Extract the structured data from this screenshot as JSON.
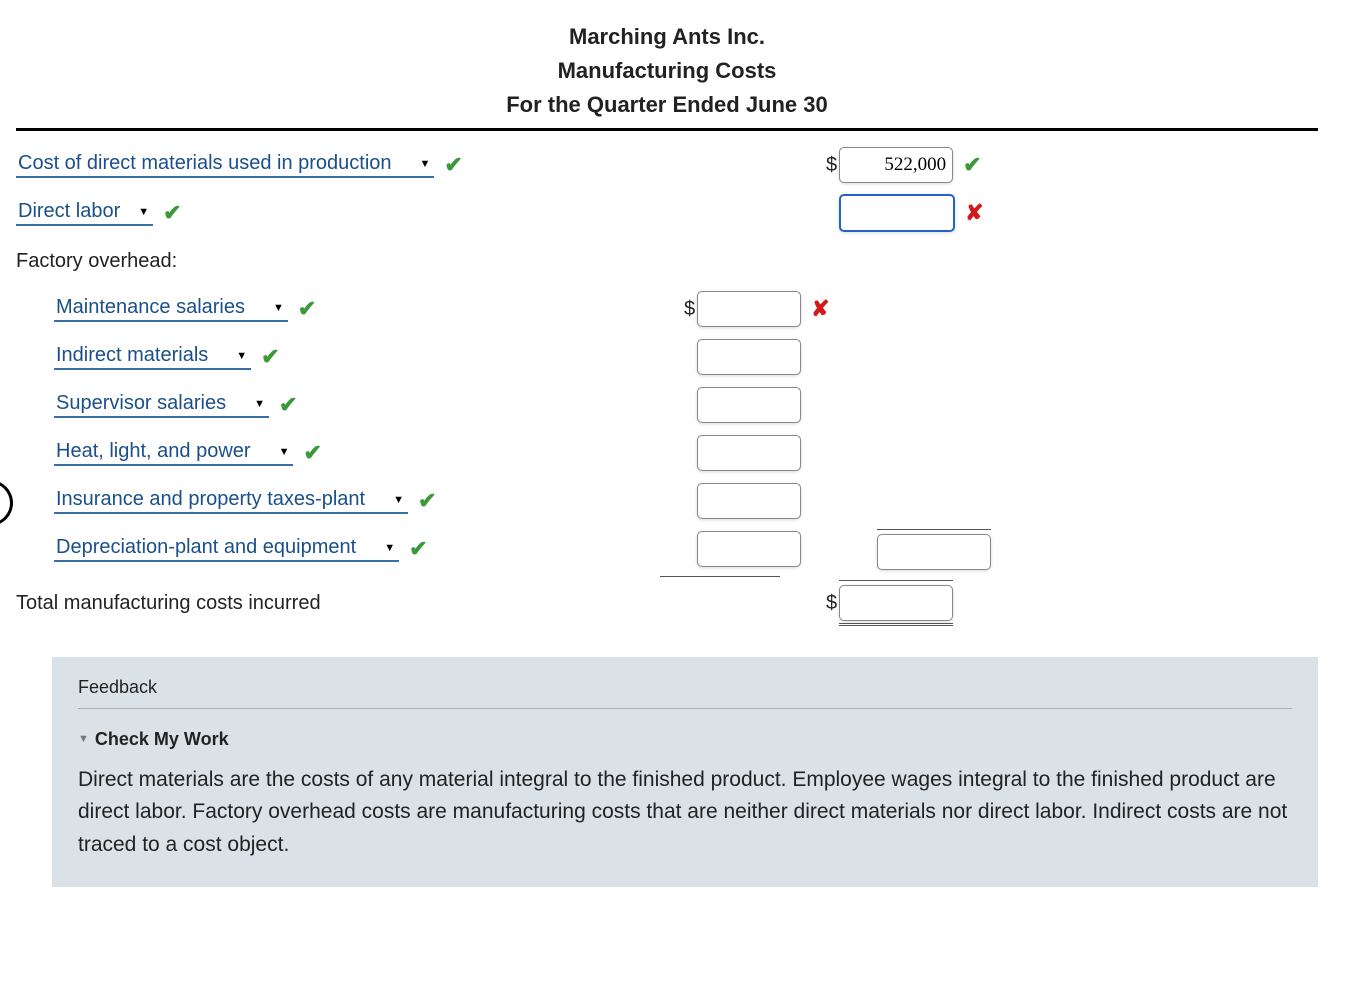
{
  "header": {
    "company": "Marching Ants Inc.",
    "title": "Manufacturing Costs",
    "period": "For the Quarter Ended June 30"
  },
  "rows": {
    "direct_materials": {
      "label": "Cost of direct materials used in production",
      "status": "ok",
      "amount": "522,000",
      "amount_status": "ok"
    },
    "direct_labor": {
      "label": "Direct labor",
      "status": "ok",
      "amount": "",
      "amount_status": "bad"
    },
    "factory_overhead_label": "Factory overhead:",
    "overhead": [
      {
        "label": "Maintenance salaries",
        "status": "ok",
        "amount": "",
        "amount_prefix": "$",
        "amount_status": "bad"
      },
      {
        "label": "Indirect materials",
        "status": "ok",
        "amount": ""
      },
      {
        "label": "Supervisor salaries",
        "status": "ok",
        "amount": ""
      },
      {
        "label": "Heat, light, and power",
        "status": "ok",
        "amount": ""
      },
      {
        "label": "Insurance and property taxes-plant",
        "status": "ok",
        "amount": ""
      },
      {
        "label": "Depreciation-plant and equipment",
        "status": "ok",
        "amount": "",
        "subtotal_amount": ""
      }
    ],
    "total": {
      "label": "Total manufacturing costs incurred",
      "amount_prefix": "$",
      "amount": ""
    }
  },
  "feedback": {
    "title": "Feedback",
    "check_label": "Check My Work",
    "text": "Direct materials are the costs of any material integral to the finished product. Employee wages integral to the finished product are direct labor. Factory overhead costs are manufacturing costs that are neither direct materials nor direct labor. Indirect costs are not traced to a cost object."
  },
  "icons": {
    "check": "✔",
    "cross": "✘",
    "caret": "▼",
    "tri": "▼"
  }
}
